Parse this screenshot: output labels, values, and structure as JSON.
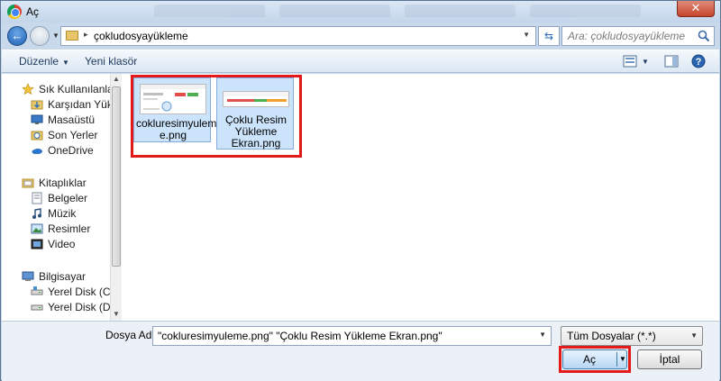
{
  "window": {
    "title": "Aç"
  },
  "address_bar": {
    "path": "çokludosyayükleme",
    "search_placeholder": "Ara: çokludosyayükleme"
  },
  "toolbar": {
    "organize_label": "Düzenle",
    "new_folder_label": "Yeni klasör"
  },
  "nav_pane": {
    "favorites_header": "Sık Kullanılanlar",
    "favorites": [
      {
        "label": "Karşıdan Yüklen",
        "icon": "downloads-icon"
      },
      {
        "label": "Masaüstü",
        "icon": "desktop-icon"
      },
      {
        "label": "Son Yerler",
        "icon": "recent-places-icon"
      },
      {
        "label": "OneDrive",
        "icon": "onedrive-icon"
      }
    ],
    "libraries_header": "Kitaplıklar",
    "libraries": [
      {
        "label": "Belgeler",
        "icon": "documents-icon"
      },
      {
        "label": "Müzik",
        "icon": "music-icon"
      },
      {
        "label": "Resimler",
        "icon": "pictures-icon"
      },
      {
        "label": "Video",
        "icon": "video-icon"
      }
    ],
    "computer_header": "Bilgisayar",
    "drives": [
      {
        "label": "Yerel Disk (C:)",
        "icon": "drive-icon"
      },
      {
        "label": "Yerel Disk (D:)",
        "icon": "drive-icon"
      }
    ]
  },
  "files": [
    {
      "name_line1": "cokluresimyulem",
      "name_line2": "e.png",
      "selected": true
    },
    {
      "name_line1": "Çoklu Resim",
      "name_line2": "Yükleme",
      "name_line3": "Ekran.png",
      "selected": true
    }
  ],
  "bottom": {
    "filename_label": "Dosya Adı:",
    "filename_value": "\"cokluresimyuleme.png\" \"Çoklu Resim Yükleme Ekran.png\"",
    "filetype_value": "Tüm Dosyalar (*.*)",
    "open_label": "Aç",
    "cancel_label": "İptal"
  },
  "colors": {
    "highlight_box": "#e41a1a",
    "selection_bg": "#cce4fb",
    "selection_border": "#84acdd"
  }
}
